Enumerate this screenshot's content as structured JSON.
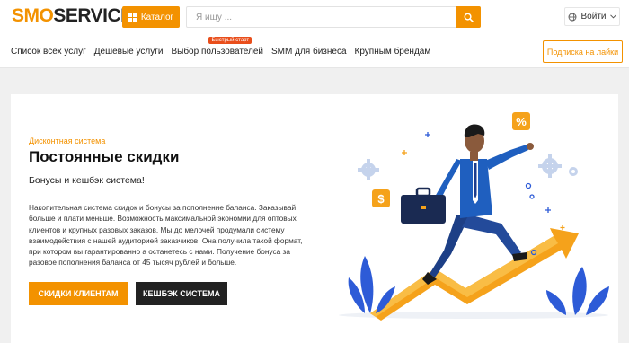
{
  "header": {
    "logo_part1": "SMO",
    "logo_part2": "SERVICE",
    "catalog_label": "Каталог",
    "search_placeholder": "Я ищу ...",
    "login_label": "Войти",
    "subscribe_label": "Подписка на лайки"
  },
  "nav": {
    "items": [
      {
        "label": "Список всех услуг"
      },
      {
        "label": "Дешевые услуги"
      },
      {
        "label": "Выбор пользователей",
        "badge": "Быстрый старт"
      },
      {
        "label": "SMM для бизнеса"
      },
      {
        "label": "Крупным брендам"
      }
    ]
  },
  "hero": {
    "eyebrow": "Дисконтная система",
    "title": "Постоянные скидки",
    "subtitle": "Бонусы и кешбэк система!",
    "description": "Накопительная система скидок и бонусы за пополнение баланса. Заказывай больше и плати меньше. Возможность максимальной экономии для оптовых клиентов и крупных разовых заказов. Мы до мелочей продумали систему взаимодействия с нашей аудиторией заказчиков. Она получила такой формат, при котором вы гарантированно а останетесь с нами. Получение бонуса за разовое пополнения баланса от 45 тысяч рублей и больше.",
    "primary_button": "СКИДКИ КЛИЕНТАМ",
    "secondary_button": "КЕШБЭК СИСТЕМА"
  },
  "illustration": {
    "percent_symbol": "%",
    "dollar_symbol": "$"
  },
  "colors": {
    "accent": "#f39200",
    "dark": "#222222",
    "figure_blue": "#1f5fbf",
    "plant_blue": "#2d5bd7"
  },
  "icons": [
    "grid-icon",
    "search-icon",
    "globe-icon",
    "chevron-down-icon",
    "gear-icon",
    "briefcase-icon",
    "percent-icon",
    "dollar-icon"
  ]
}
